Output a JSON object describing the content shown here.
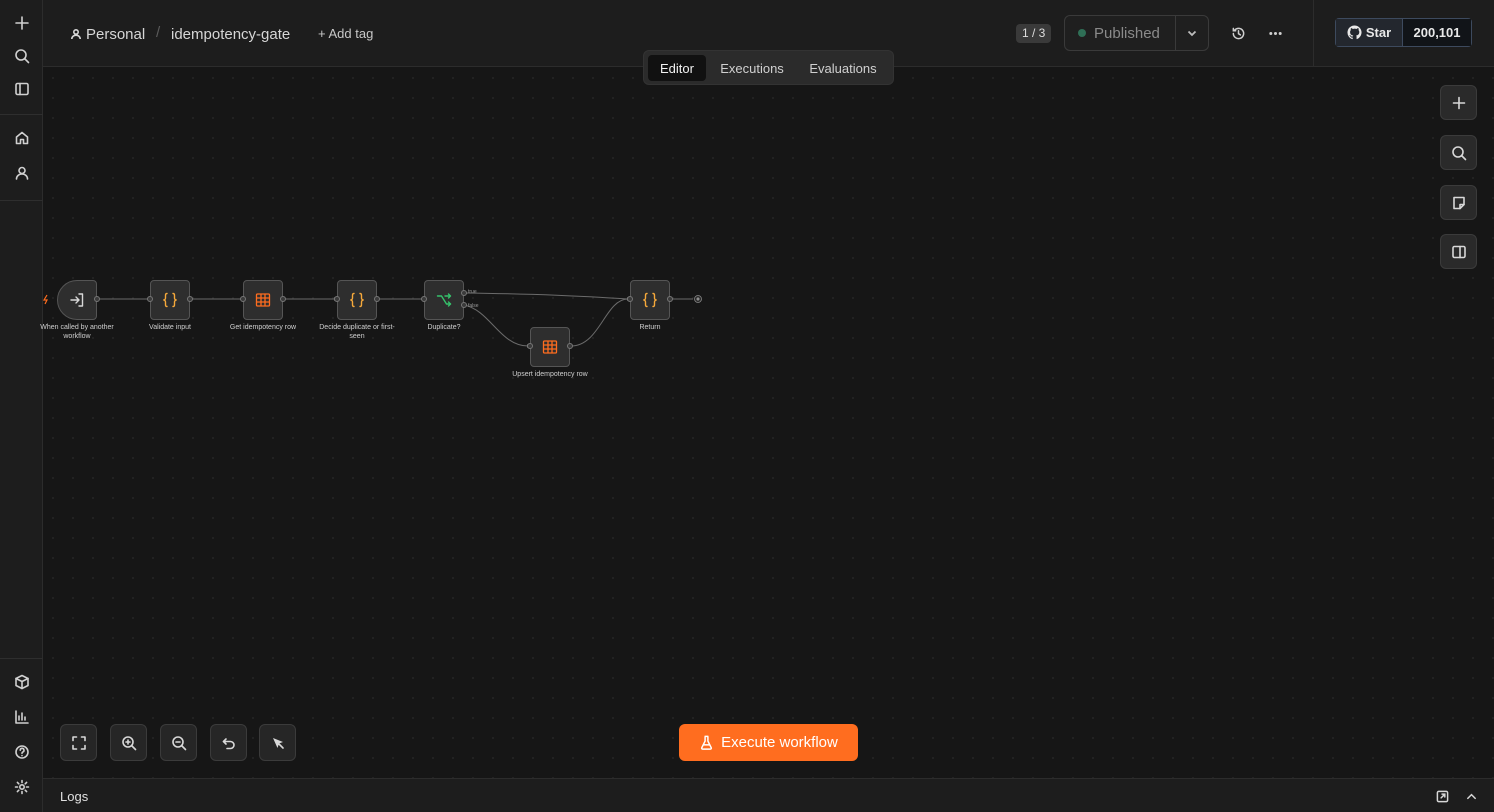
{
  "header": {
    "project": "Personal",
    "workflow_name": "idempotency-gate",
    "add_tag": "+ Add tag",
    "version": "1 / 3",
    "publish_status": "Published",
    "github_star": "Star",
    "github_count": "200,101"
  },
  "tabs": [
    {
      "label": "Editor",
      "active": true
    },
    {
      "label": "Executions",
      "active": false
    },
    {
      "label": "Evaluations",
      "active": false
    }
  ],
  "nodes": [
    {
      "label": "When called by another workflow",
      "icon": "sign-in-icon",
      "type": "trigger"
    },
    {
      "label": "Validate input",
      "icon": "code-braces-icon",
      "type": "code"
    },
    {
      "label": "Get idempotency row",
      "icon": "table-icon",
      "type": "data-table"
    },
    {
      "label": "Decide duplicate or first-seen",
      "icon": "code-braces-icon",
      "type": "code"
    },
    {
      "label": "Duplicate?",
      "icon": "if-branch-icon",
      "type": "if"
    },
    {
      "label": "Upsert idempotency row",
      "icon": "table-icon",
      "type": "data-table"
    },
    {
      "label": "Return",
      "icon": "code-braces-icon",
      "type": "code"
    }
  ],
  "branch_labels": {
    "true": "true",
    "false": "false"
  },
  "execute_button": "Execute workflow",
  "logs": {
    "title": "Logs"
  },
  "colors": {
    "accent": "#ff6d1f",
    "code_icon": "#f6a93b",
    "table_icon": "#ff6d1f",
    "if_icon": "#35c26b",
    "published_dot": "#2f6f56"
  }
}
